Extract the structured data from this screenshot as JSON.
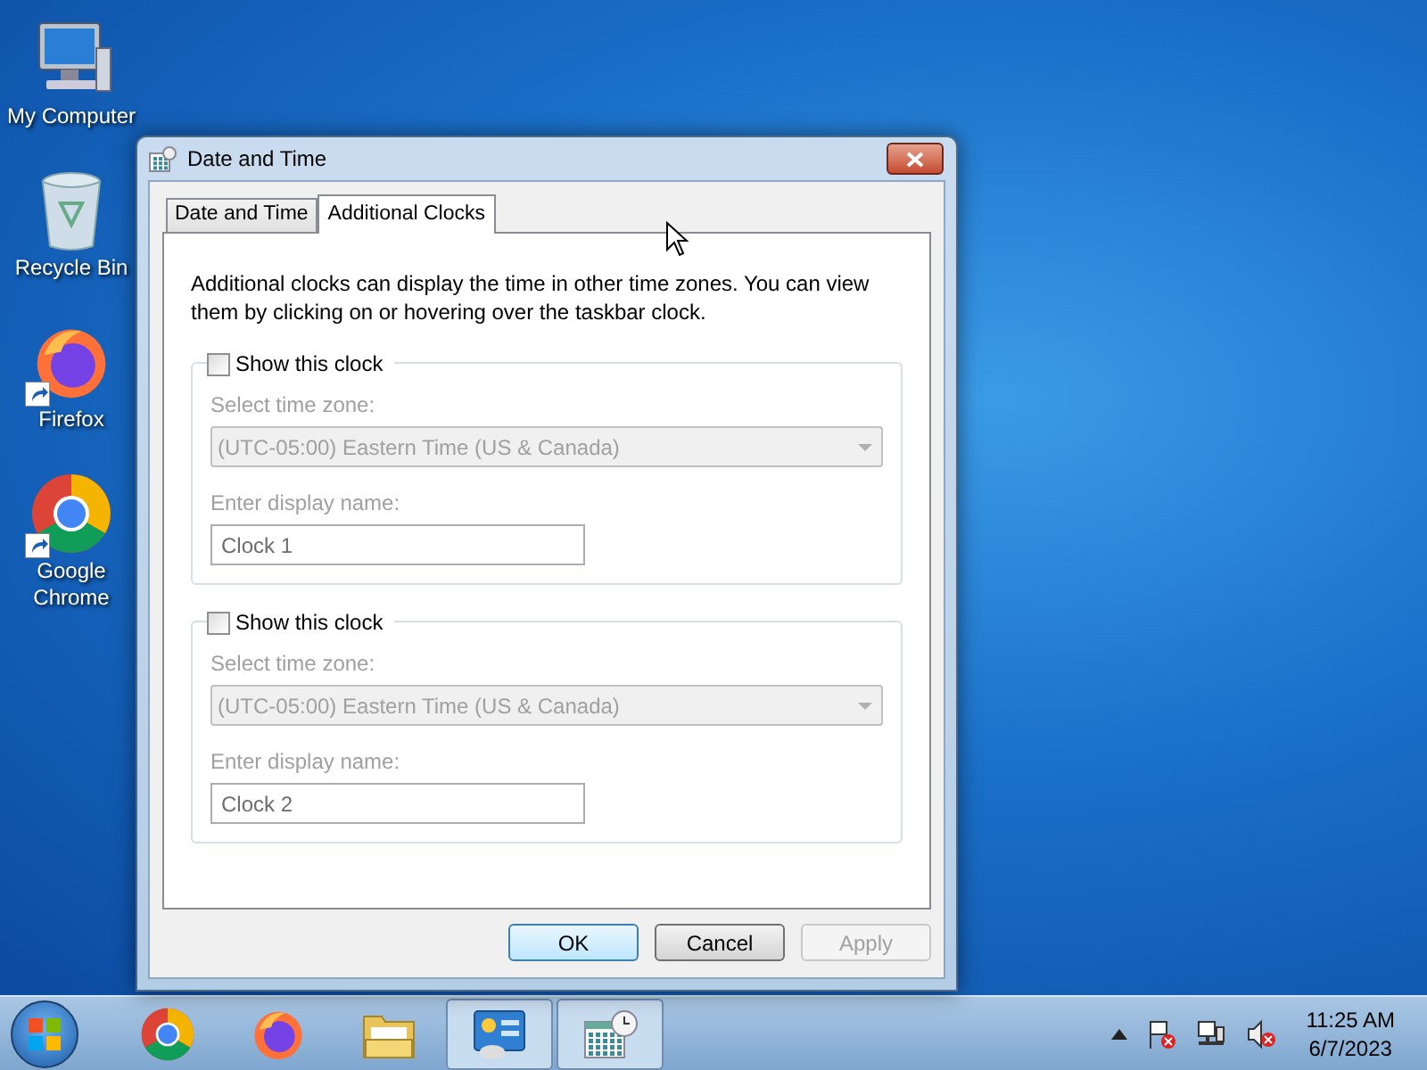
{
  "desktop_icons": [
    {
      "label": "My Computer",
      "kind": "computer",
      "shortcut": false
    },
    {
      "label": "Recycle Bin",
      "kind": "recycle",
      "shortcut": false
    },
    {
      "label": "Firefox",
      "kind": "firefox",
      "shortcut": true
    },
    {
      "label": "Google Chrome",
      "kind": "chrome",
      "shortcut": true
    }
  ],
  "window": {
    "title": "Date and Time",
    "tabs": [
      {
        "label": "Date and Time",
        "selected": false
      },
      {
        "label": "Additional Clocks",
        "selected": true
      }
    ],
    "description": "Additional clocks can display the time in other time zones. You can view them by clicking on or hovering over the taskbar clock.",
    "clocks": [
      {
        "show_label": "Show this clock",
        "checked": false,
        "timezone_label": "Select time zone:",
        "timezone": "(UTC-05:00) Eastern Time (US & Canada)",
        "name_label": "Enter display name:",
        "name": "Clock 1"
      },
      {
        "show_label": "Show this clock",
        "checked": false,
        "timezone_label": "Select time zone:",
        "timezone": "(UTC-05:00) Eastern Time (US & Canada)",
        "name_label": "Enter display name:",
        "name": "Clock 2"
      }
    ],
    "buttons": [
      {
        "label": "OK",
        "default": true,
        "disabled": false
      },
      {
        "label": "Cancel",
        "default": false,
        "disabled": false
      },
      {
        "label": "Apply",
        "default": false,
        "disabled": true
      }
    ]
  },
  "taskbar": {
    "items": [
      {
        "kind": "chrome",
        "active": false
      },
      {
        "kind": "firefox",
        "active": false
      },
      {
        "kind": "folder",
        "active": false
      },
      {
        "kind": "control-panel",
        "active": true
      },
      {
        "kind": "calendar",
        "active": true
      }
    ],
    "time": "11:25 AM",
    "date": "6/7/2023"
  }
}
